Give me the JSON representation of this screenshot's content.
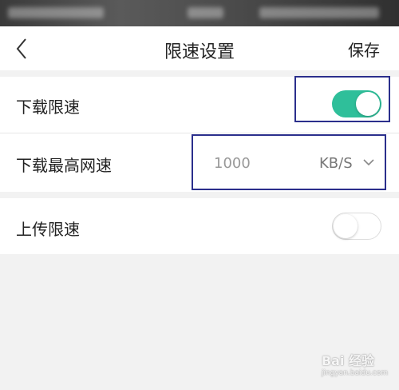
{
  "nav": {
    "title": "限速设置",
    "save_label": "保存"
  },
  "settings": {
    "download_limit": {
      "label": "下载限速",
      "enabled": true
    },
    "max_download_speed": {
      "label": "下载最高网速",
      "value": "1000",
      "unit": "KB/S"
    },
    "upload_limit": {
      "label": "上传限速",
      "enabled": false
    }
  },
  "colors": {
    "toggle_on": "#2fbf9a",
    "highlight_box": "#2b2f8c"
  },
  "icons": {
    "back": "chevron-left-icon",
    "dropdown": "chevron-down-icon"
  },
  "watermark": {
    "brand": "Bai 经验",
    "url": "jingyan.baidu.com"
  }
}
